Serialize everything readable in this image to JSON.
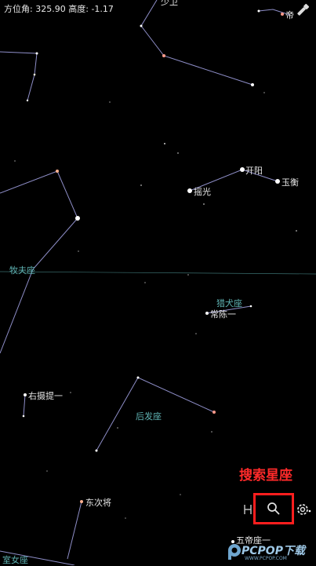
{
  "status": {
    "azimuth_label": "方位角:",
    "azimuth": "325.90",
    "altitude_label": "高度:",
    "altitude": "-1.17"
  },
  "stars": [
    {
      "name": "开阳"
    },
    {
      "name": "玉衡"
    },
    {
      "name": "摇光"
    },
    {
      "name": "常陈一"
    },
    {
      "name": "右摄提一"
    },
    {
      "name": "东次将"
    },
    {
      "name": "五帝座一"
    },
    {
      "name": "帝"
    },
    {
      "name": "少卫"
    }
  ],
  "constellations": [
    {
      "name": "牧夫座"
    },
    {
      "name": "猎犬座"
    },
    {
      "name": "后发座"
    },
    {
      "name": "室女座"
    }
  ],
  "annotation": "搜索星座",
  "icons": {
    "search": "search-icon",
    "settings": "gear-icon",
    "torch": "flashlight-icon",
    "gyro": "gyroscope-icon"
  },
  "watermark": {
    "brand": "PCPOP下载",
    "sub": "WWW.PCPOP.COM"
  },
  "colors": {
    "line": "#9b9bd6",
    "constellation_label": "#5fb3b3",
    "annotation": "#ff2a2a"
  }
}
